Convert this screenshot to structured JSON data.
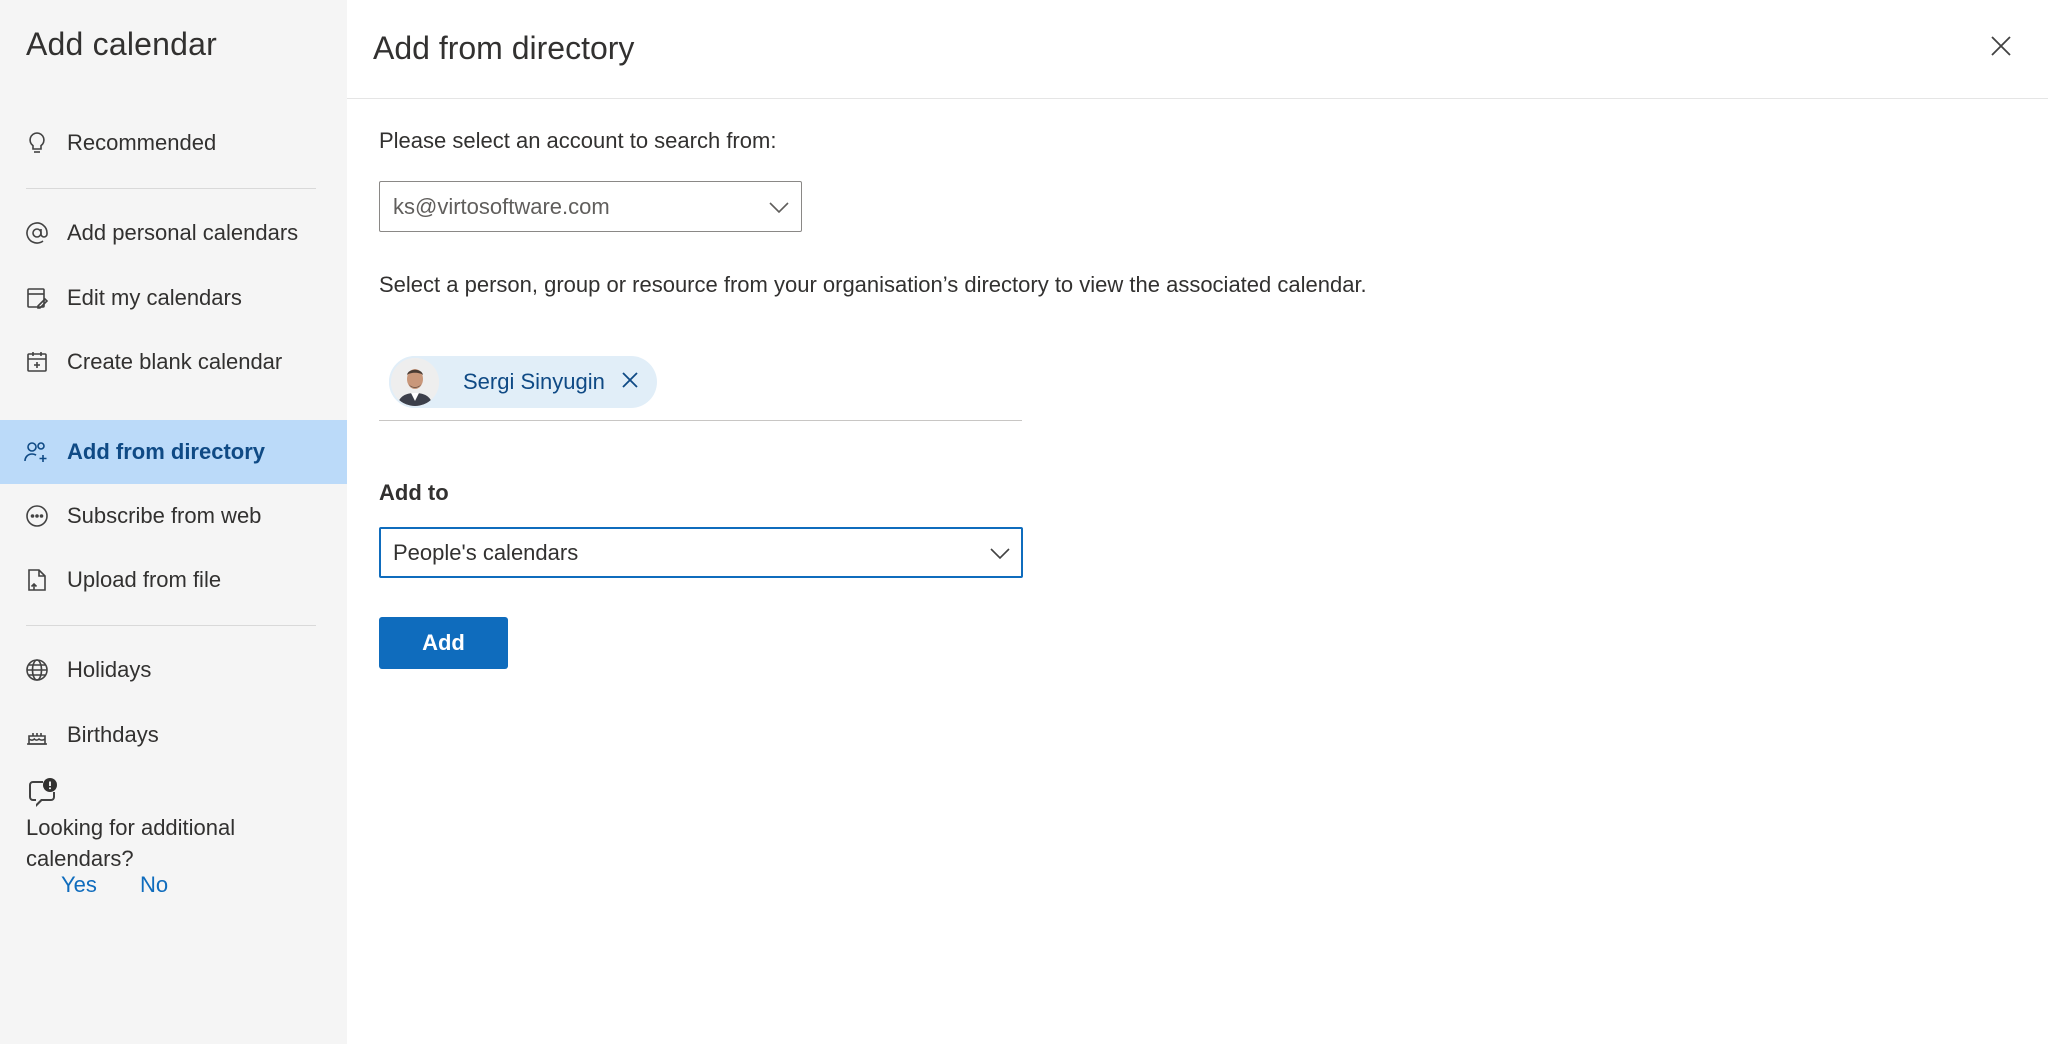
{
  "sidebar": {
    "title": "Add calendar",
    "items": [
      {
        "label": "Recommended",
        "icon": "lightbulb-icon"
      },
      {
        "label": "Add personal calendars",
        "icon": "at-sign-icon"
      },
      {
        "label": "Edit my calendars",
        "icon": "edit-calendar-icon"
      },
      {
        "label": "Create blank calendar",
        "icon": "calendar-add-icon"
      },
      {
        "label": "Add from directory",
        "icon": "people-add-icon",
        "active": true
      },
      {
        "label": "Subscribe from web",
        "icon": "web-link-icon"
      },
      {
        "label": "Upload from file",
        "icon": "file-upload-icon"
      },
      {
        "label": "Holidays",
        "icon": "globe-icon"
      },
      {
        "label": "Birthdays",
        "icon": "cake-icon"
      }
    ],
    "feedback": {
      "icon": "chat-alert-icon",
      "question": "Looking for additional calendars?",
      "yes": "Yes",
      "no": "No"
    }
  },
  "main": {
    "title": "Add from directory",
    "close_icon": "close-icon",
    "account_prompt": "Please select an account to search from:",
    "account_value": "ks@virtosoftware.com",
    "directory_description": "Select a person, group or resource from your organisation’s directory to view the associated calendar.",
    "selected_person": "Sergi Sinyugin",
    "add_to_label": "Add to",
    "add_to_value": "People's calendars",
    "add_button": "Add"
  },
  "colors": {
    "accent": "#0f6cbd",
    "active_nav_bg": "#bbdaf9",
    "sidebar_bg": "#f5f5f5",
    "chip_bg": "#e1eef8"
  }
}
